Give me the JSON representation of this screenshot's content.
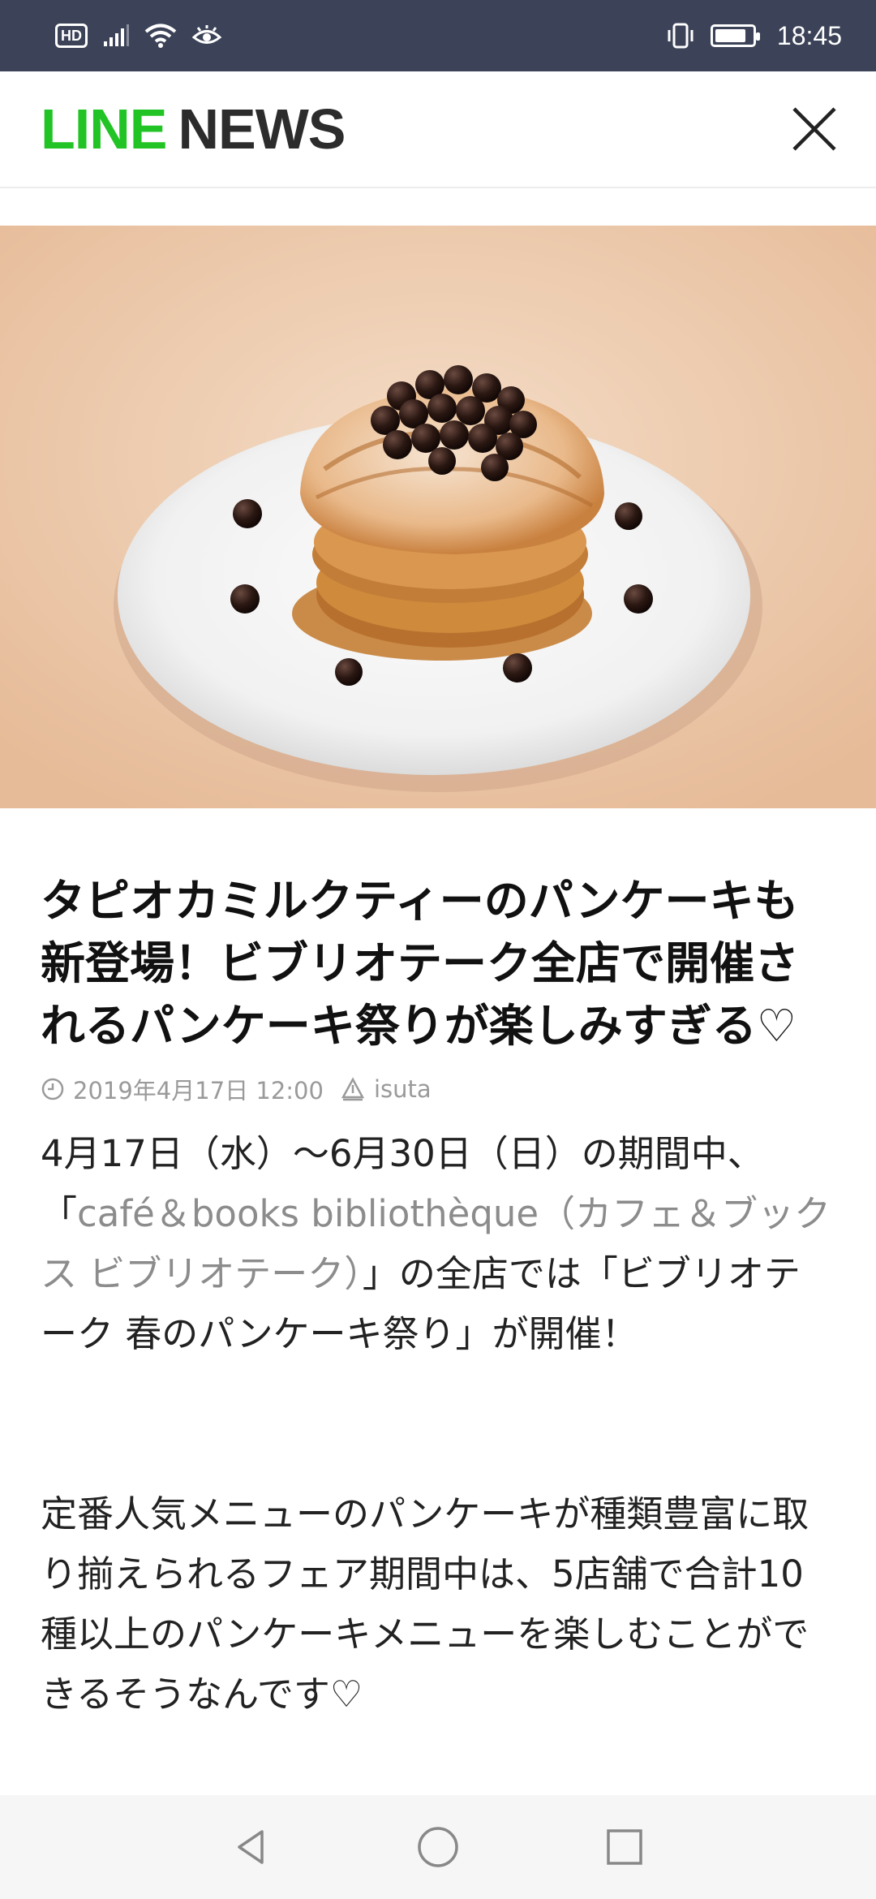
{
  "status_bar": {
    "hd_badge": "HD",
    "time": "18:45",
    "battery_level": 0.85,
    "icons": [
      "hd-icon",
      "signal-icon",
      "wifi-icon",
      "eye-icon",
      "vibrate-icon",
      "battery-icon"
    ]
  },
  "header": {
    "brand_line": "LINE",
    "brand_news": "NEWS",
    "close_icon": "close-icon",
    "brand_color": "#22c325"
  },
  "hero": {
    "image_label": "photo"
  },
  "article": {
    "title": "タピオカミルクティーのパンケーキも新登場！ビブリオテーク全店で開催されるパンケーキ祭りが楽しみすぎる♡",
    "date": "2019年4月17日 12:00",
    "source": "isuta",
    "para1_a": "4月17日（水）〜6月30日（日）の期間中、「",
    "para1_link": "café＆books bibliothèque（カフェ＆ブックス ビブリオテーク）",
    "para1_b": "」の全店では「ビブリオテーク 春のパンケーキ祭り」が開催！",
    "para2": "定番人気メニューのパンケーキが種類豊富に取り揃えられるフェア期間中は、5店舗で合計10種以上のパンケーキメニューを楽しむことができるそうなんです♡",
    "link_color": "#8c8c8c"
  },
  "nav_bar": {
    "buttons": [
      "back-icon",
      "home-icon",
      "recents-icon"
    ]
  }
}
